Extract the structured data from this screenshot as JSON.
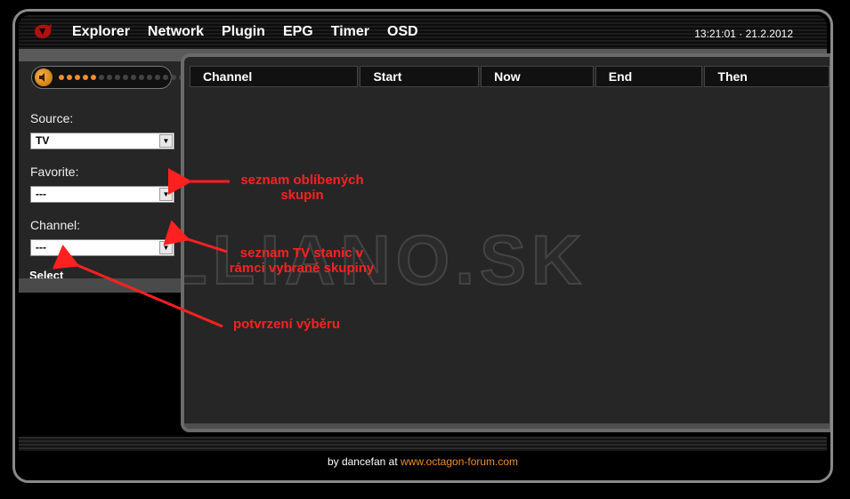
{
  "nav": {
    "items": [
      {
        "label": "Explorer"
      },
      {
        "label": "Network"
      },
      {
        "label": "Plugin"
      },
      {
        "label": "EPG"
      },
      {
        "label": "Timer"
      },
      {
        "label": "OSD"
      }
    ]
  },
  "header": {
    "datetime": "13:21:01 · 21.2.2012"
  },
  "volume": {
    "level_dots": 5,
    "total_dots": 17
  },
  "sidebar": {
    "source_label": "Source:",
    "source_value": "TV",
    "favorite_label": "Favorite:",
    "favorite_value": "---",
    "channel_label": "Channel:",
    "channel_value": "---",
    "select_label": "Select"
  },
  "table": {
    "columns": [
      "Channel",
      "Start",
      "Now",
      "End",
      "Then"
    ]
  },
  "watermark": "ELLIANO.SK",
  "annotations": {
    "favorite": "seznam oblíbených skupin",
    "channel": "seznam TV stanic v rámci vybrané skupiny",
    "select": "potvrzení výběru"
  },
  "footer": {
    "prefix": "by dancefan at ",
    "link": "www.octagon-forum.com"
  },
  "colors": {
    "accent": "#f28c28",
    "annotation": "#ff2020"
  }
}
